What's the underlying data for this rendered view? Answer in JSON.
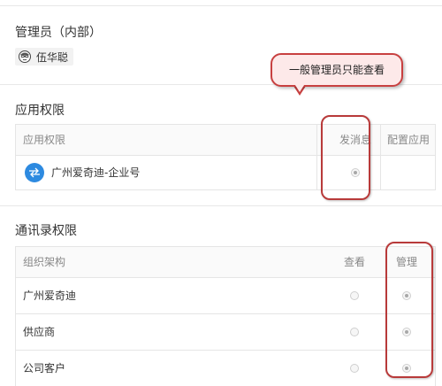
{
  "admin_section": {
    "title": "管理员（内部）",
    "admin_name": "伍华聪"
  },
  "annotation": {
    "callout_text": "一般管理员只能查看",
    "color": "#c84040"
  },
  "app_permissions": {
    "title": "应用权限",
    "headers": [
      "应用权限",
      "发消息",
      "配置应用"
    ],
    "rows": [
      {
        "name": "广州爱奇迪-企业号",
        "icon": "exchange-arrows-icon",
        "send_message": true,
        "configure": false
      }
    ]
  },
  "contacts_permissions": {
    "title": "通讯录权限",
    "headers": [
      "组织架构",
      "查看",
      "管理"
    ],
    "rows": [
      {
        "name": "广州爱奇迪",
        "view": false,
        "manage": true
      },
      {
        "name": "供应商",
        "view": false,
        "manage": true
      },
      {
        "name": "公司客户",
        "view": false,
        "manage": true
      }
    ]
  },
  "colors": {
    "accent_blue": "#2d8ae0",
    "border": "#e5e5e5"
  }
}
